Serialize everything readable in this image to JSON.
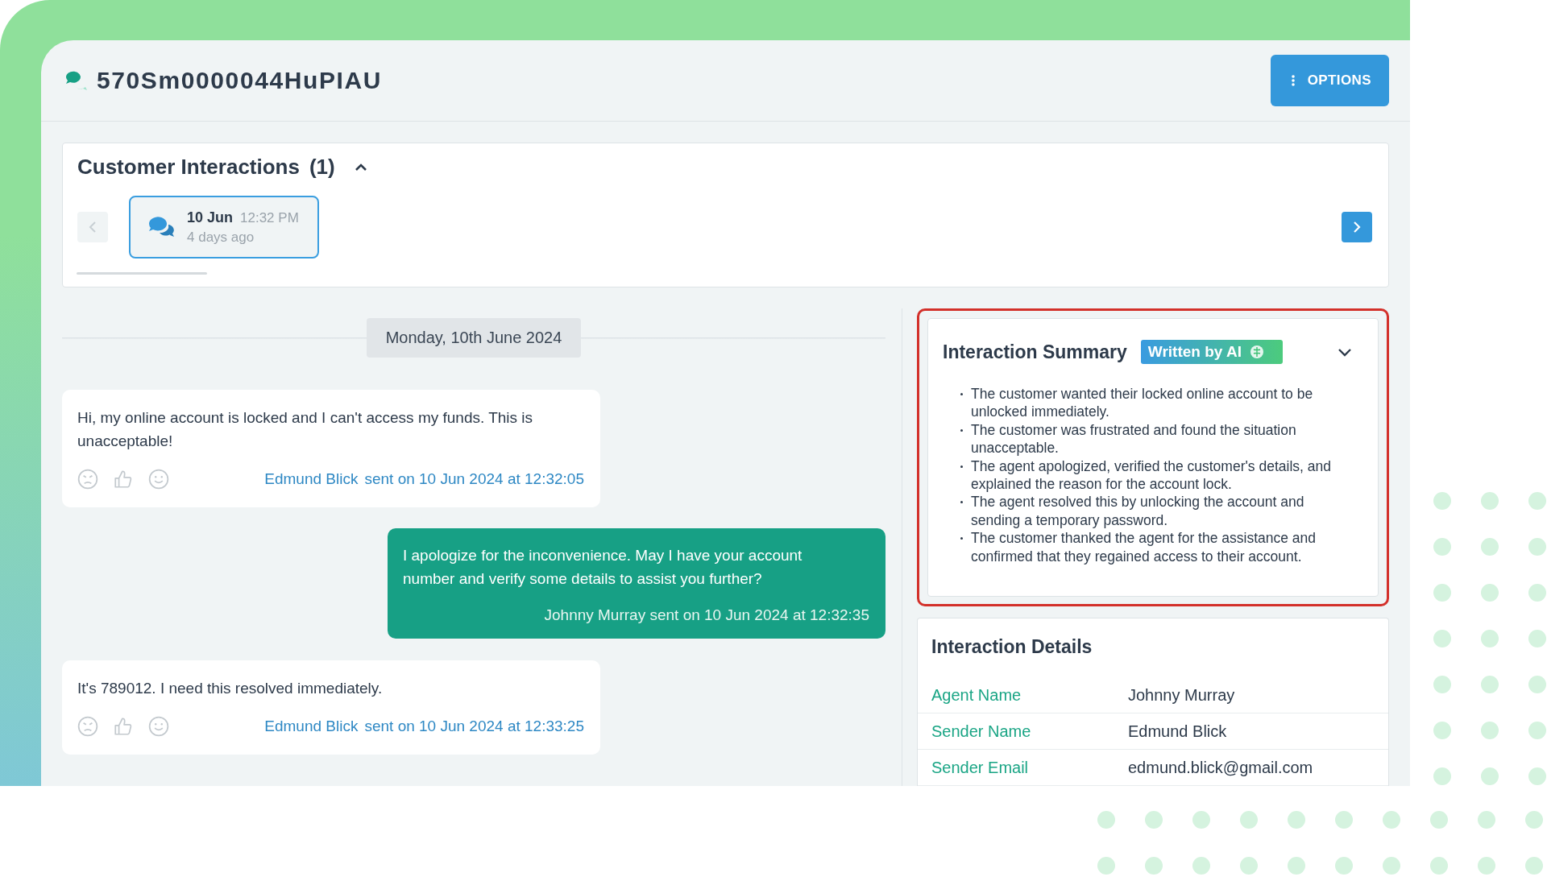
{
  "header": {
    "title": "570Sm0000044HuPIAU",
    "options_button": "OPTIONS"
  },
  "interactions": {
    "title": "Customer Interactions",
    "count": "(1)",
    "expanded": true,
    "prev": {
      "disabled": true
    },
    "next": {
      "disabled": false
    },
    "items": [
      {
        "date": "10 Jun",
        "time": "12:32 PM",
        "ago": "4 days ago",
        "selected": true
      }
    ]
  },
  "conversation": {
    "date_divider": "Monday, 10th June 2024",
    "messages": [
      {
        "kind": "inbound",
        "text": "Hi, my online account is locked and I can't access my funds. This is unacceptable!",
        "sender": "Edmund Blick",
        "sent": "sent on 10 Jun 2024 at 12:32:05"
      },
      {
        "kind": "outbound",
        "text": "I apologize for the inconvenience. May I have your account number and verify some details to assist you further?",
        "meta": "Johnny Murray sent on 10 Jun 2024 at 12:32:35"
      },
      {
        "kind": "inbound",
        "text": "It's 789012. I need this resolved immediately.",
        "sender": "Edmund Blick",
        "sent": "sent on 10 Jun 2024 at 12:33:25"
      }
    ]
  },
  "summary": {
    "title": "Interaction Summary",
    "badge": "Written by AI",
    "highlighted": true,
    "bullets": [
      "The customer wanted their locked online account to be unlocked immediately.",
      "The customer was frustrated and found the situation unacceptable.",
      "The agent apologized, verified the customer's details, and explained the reason for the account lock.",
      "The agent resolved this by unlocking the account and sending a temporary password.",
      "The customer thanked the agent for the assistance and confirmed that they regained access to their account."
    ]
  },
  "details": {
    "title": "Interaction Details",
    "rows": [
      {
        "label": "Agent Name",
        "value": "Johnny Murray"
      },
      {
        "label": "Sender Name",
        "value": "Edmund Blick"
      },
      {
        "label": "Sender Email",
        "value": "edmund.blick@gmail.com"
      }
    ]
  }
}
